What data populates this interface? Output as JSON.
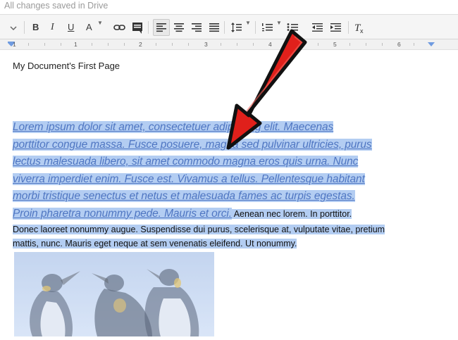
{
  "status": {
    "saved_text": "All changes saved in Drive"
  },
  "toolbar": {
    "bold_label": "B",
    "italic_label": "I",
    "underline_label": "U",
    "text_color_label": "A",
    "icons": [
      "chevron-down-icon",
      "link-icon",
      "comment-icon",
      "align-left-icon",
      "align-center-icon",
      "align-right-icon",
      "align-justify-icon",
      "line-spacing-icon",
      "numbered-list-icon",
      "bulleted-list-icon",
      "decrease-indent-icon",
      "increase-indent-icon",
      "clear-formatting-icon"
    ]
  },
  "ruler": {
    "numbers": [
      "1",
      "1",
      "2",
      "3",
      "4",
      "5",
      "6"
    ]
  },
  "document": {
    "heading": "My Document's First Page",
    "selected_lines": [
      "Lorem ipsum dolor sit amet, consectetuer adipiscing elit. Maecenas",
      "porttitor congue massa. Fusce posuere, magna sed pulvinar ultricies, purus",
      "lectus malesuada libero, sit amet commodo magna eros quis urna. Nunc",
      "viverra imperdiet enim. Fusce est. Vivamus a tellus. Pellentesque habitant",
      "morbi tristique senectus et netus et malesuada fames ac turpis egestas."
    ],
    "mixed_line_lorem": "Proin pharetra nonummy pede. Mauris et orci.",
    "mixed_line_plain": " Aenean nec lorem. In porttitor.",
    "plain_lines": [
      "Donec laoreet nonummy augue. Suspendisse dui purus, scelerisque at, vulputate vitae, pretium",
      "mattis, nunc. Mauris eget neque at sem venenatis eleifend. Ut nonummy."
    ]
  },
  "colors": {
    "selection": "#b3cdf2",
    "link_text": "#4f76c2",
    "arrow": "#e0201b"
  }
}
